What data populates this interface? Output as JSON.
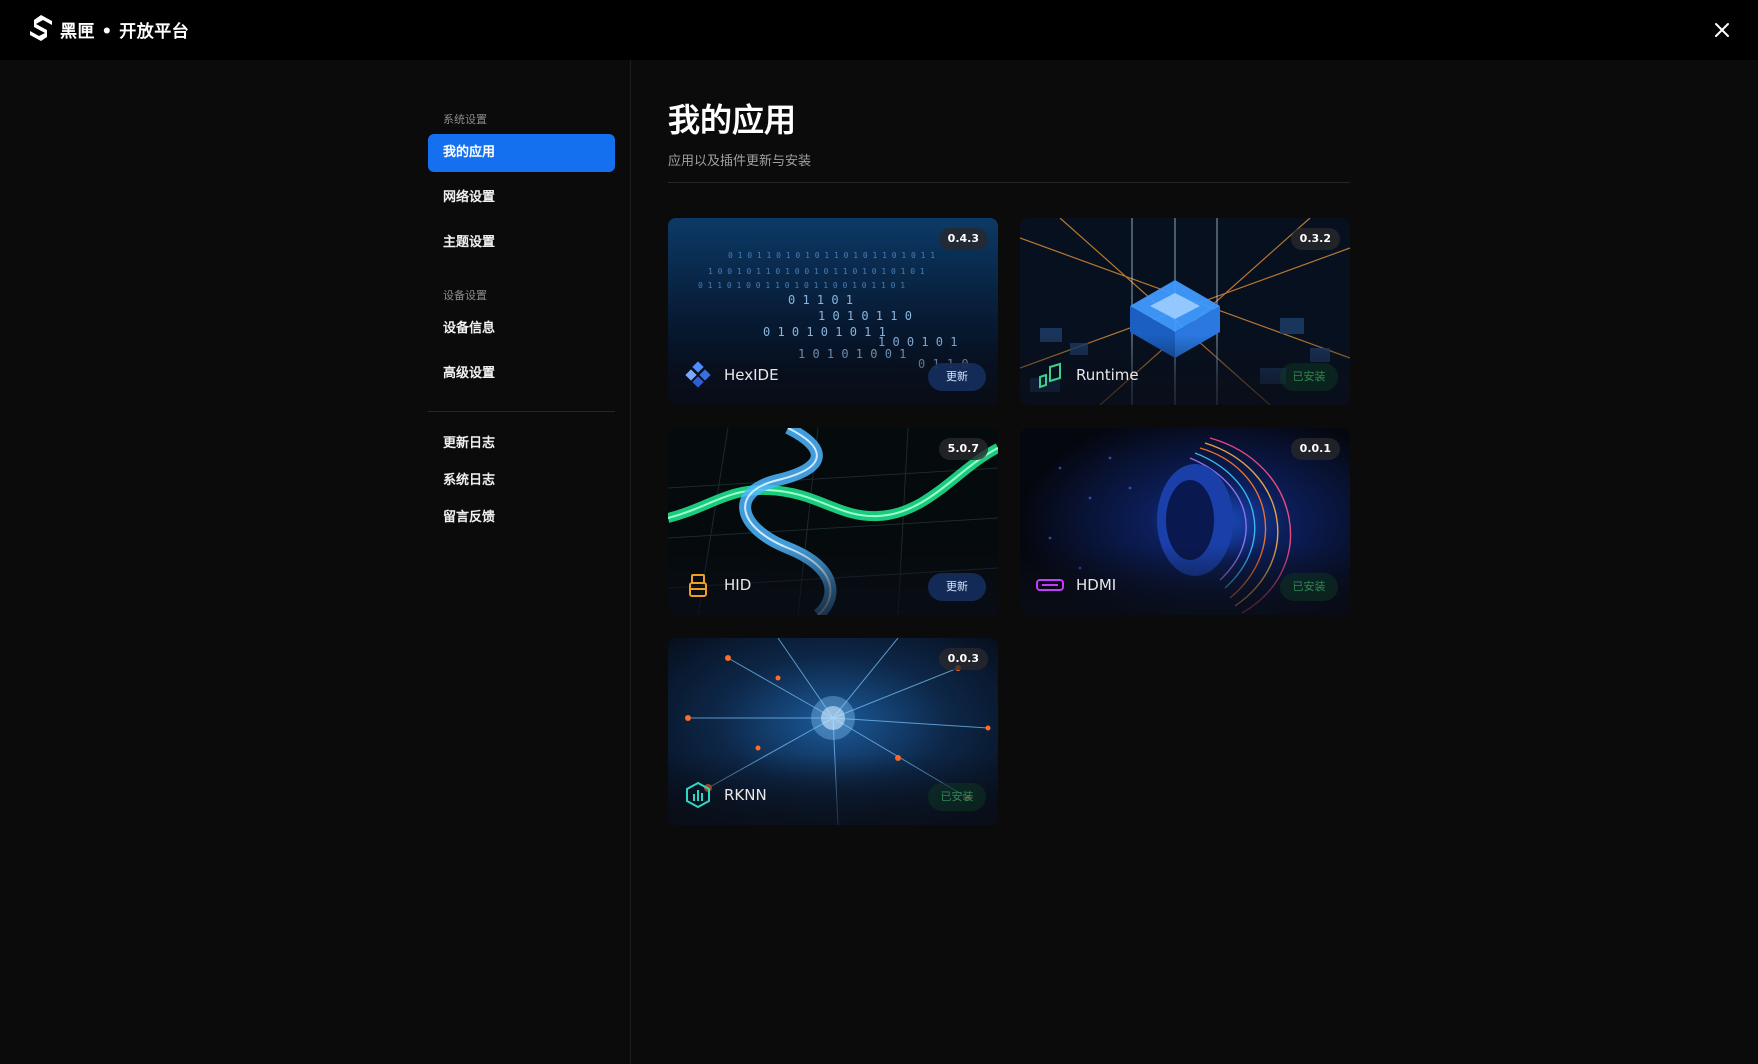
{
  "app": {
    "title": "黑匣 • 开放平台"
  },
  "sidebar": {
    "sections": [
      {
        "label": "系统设置"
      },
      {
        "label": "设备设置"
      }
    ],
    "items": [
      {
        "label": "我的应用",
        "active": true
      },
      {
        "label": "网络设置"
      },
      {
        "label": "主题设置"
      },
      {
        "label": "设备信息"
      },
      {
        "label": "高级设置"
      },
      {
        "label": "更新日志"
      },
      {
        "label": "系统日志"
      },
      {
        "label": "留言反馈"
      }
    ]
  },
  "page": {
    "title": "我的应用",
    "subtitle": "应用以及插件更新与安装"
  },
  "apps": [
    {
      "name": "HexIDE",
      "version": "0.4.3",
      "action": "更新",
      "status": "update",
      "icon": "hexide-icon"
    },
    {
      "name": "Runtime",
      "version": "0.3.2",
      "action": "已安装",
      "status": "installed",
      "icon": "runtime-icon"
    },
    {
      "name": "HID",
      "version": "5.0.7",
      "action": "更新",
      "status": "update",
      "icon": "usb-icon"
    },
    {
      "name": "HDMI",
      "version": "0.0.1",
      "action": "已安装",
      "status": "installed",
      "icon": "hdmi-icon"
    },
    {
      "name": "RKNN",
      "version": "0.0.3",
      "action": "已安装",
      "status": "installed",
      "icon": "rknn-icon"
    }
  ],
  "colors": {
    "accent": "#1570ef",
    "background": "#0b0b0b",
    "titlebar": "#000000"
  }
}
